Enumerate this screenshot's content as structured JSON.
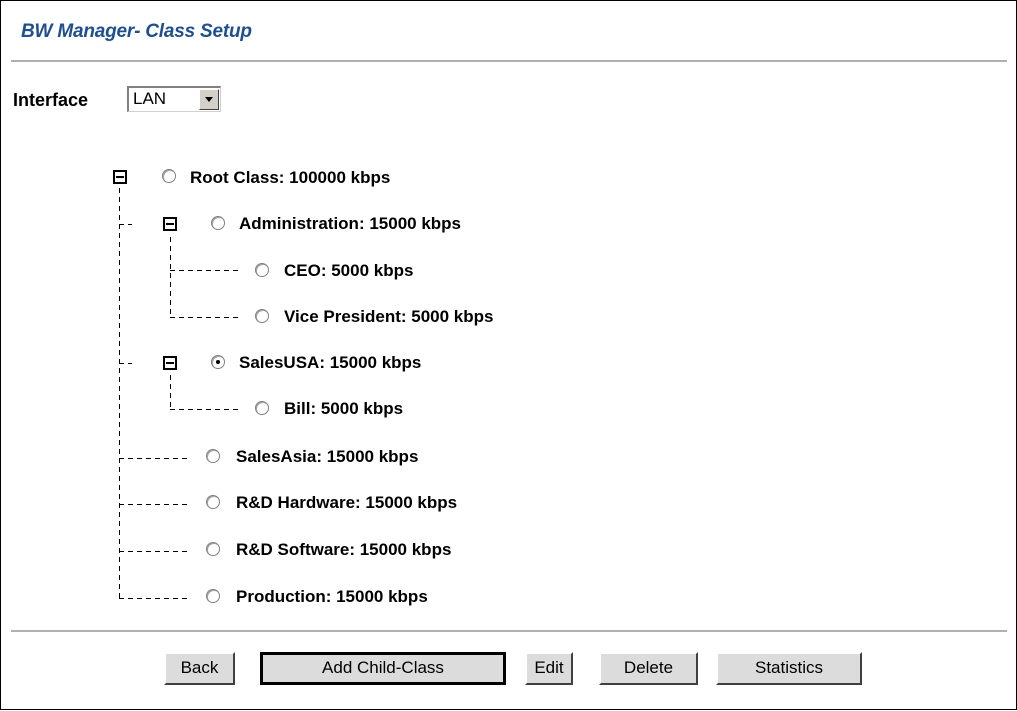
{
  "page": {
    "title": "BW Manager- Class Setup"
  },
  "interface": {
    "label": "Interface",
    "selected": "LAN"
  },
  "tree": {
    "nodes": [
      {
        "id": "root",
        "label": "Root Class: 100000 kbps",
        "selected": false,
        "expandable": true
      },
      {
        "id": "administration",
        "label": "Administration: 15000 kbps",
        "selected": false,
        "expandable": true
      },
      {
        "id": "ceo",
        "label": "CEO: 5000 kbps",
        "selected": false,
        "expandable": false
      },
      {
        "id": "vice-president",
        "label": "Vice President: 5000 kbps",
        "selected": false,
        "expandable": false
      },
      {
        "id": "salesusa",
        "label": "SalesUSA: 15000 kbps",
        "selected": true,
        "expandable": true
      },
      {
        "id": "bill",
        "label": "Bill: 5000 kbps",
        "selected": false,
        "expandable": false
      },
      {
        "id": "salesasia",
        "label": "SalesAsia: 15000 kbps",
        "selected": false,
        "expandable": false
      },
      {
        "id": "rd-hardware",
        "label": "R&D Hardware: 15000 kbps",
        "selected": false,
        "expandable": false
      },
      {
        "id": "rd-software",
        "label": "R&D Software: 15000 kbps",
        "selected": false,
        "expandable": false
      },
      {
        "id": "production",
        "label": "Production: 15000 kbps",
        "selected": false,
        "expandable": false
      }
    ]
  },
  "buttons": {
    "back": "Back",
    "add_child": "Add Child-Class",
    "edit": "Edit",
    "delete": "Delete",
    "statistics": "Statistics"
  }
}
